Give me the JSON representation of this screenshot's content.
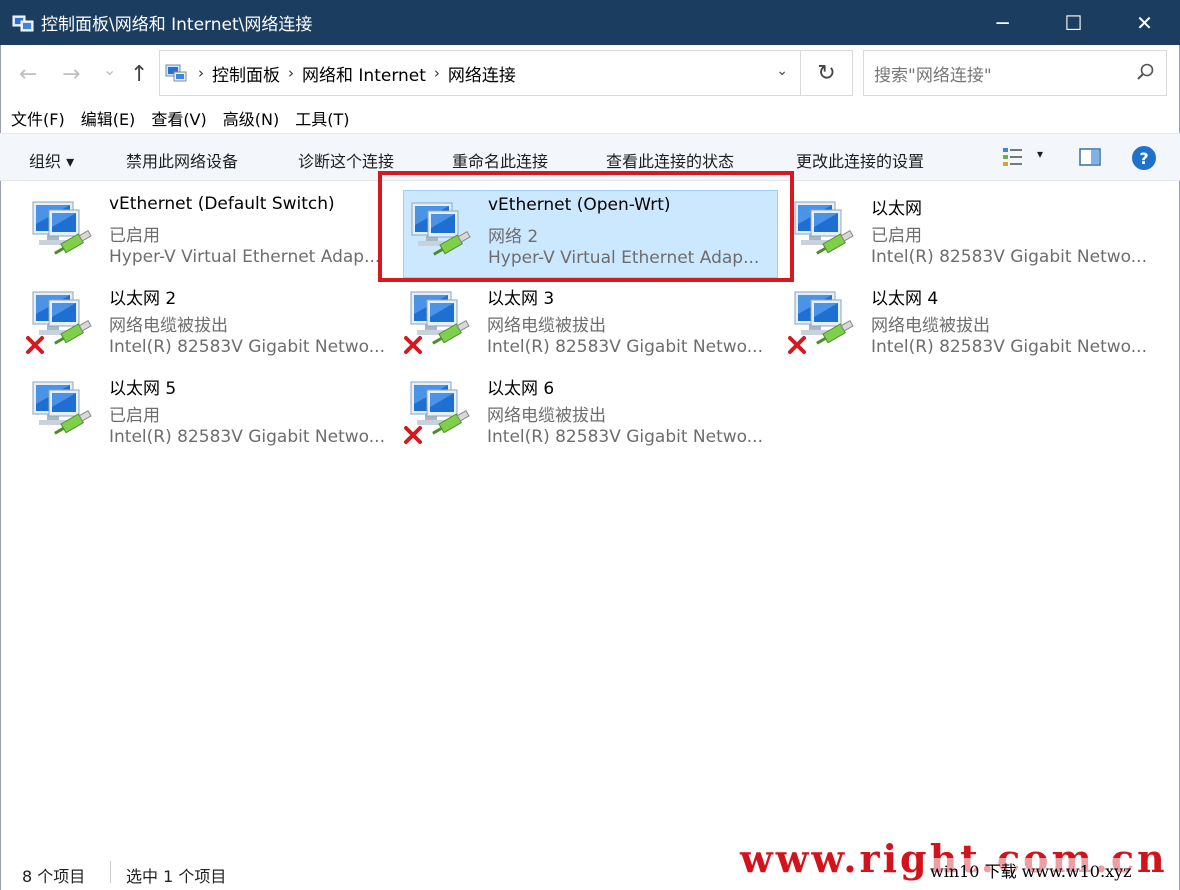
{
  "window": {
    "title": "控制面板\\网络和 Internet\\网络连接",
    "minimize": "─",
    "maximize": "☐",
    "close": "✕"
  },
  "nav": {
    "back": "←",
    "forward": "→",
    "recent": "⌄",
    "up": "↑",
    "breadcrumb": [
      "控制面板",
      "网络和 Internet",
      "网络连接"
    ],
    "dropdown": "⌄",
    "refresh": "↻",
    "search_placeholder": "搜索\"网络连接\""
  },
  "menu": [
    "文件(F)",
    "编辑(E)",
    "查看(V)",
    "高级(N)",
    "工具(T)"
  ],
  "commands": {
    "organize": "组织 ▾",
    "disable": "禁用此网络设备",
    "diagnose": "诊断这个连接",
    "rename": "重命名此连接",
    "status": "查看此连接的状态",
    "settings": "更改此连接的设置",
    "view_arrow": "▾",
    "help": "?"
  },
  "connections": [
    {
      "name": "vEthernet (Default Switch)",
      "status": "已启用",
      "adapter": "Hyper-V Virtual Ethernet Adap...",
      "unplugged": false,
      "selected": false
    },
    {
      "name": "vEthernet (Open-Wrt)",
      "status": "网络 2",
      "adapter": "Hyper-V Virtual Ethernet Adap...",
      "unplugged": false,
      "selected": true
    },
    {
      "name": "以太网",
      "status": "已启用",
      "adapter": "Intel(R) 82583V Gigabit Netwo...",
      "unplugged": false,
      "selected": false
    },
    {
      "name": "以太网 2",
      "status": "网络电缆被拔出",
      "adapter": "Intel(R) 82583V Gigabit Netwo...",
      "unplugged": true,
      "selected": false
    },
    {
      "name": "以太网 3",
      "status": "网络电缆被拔出",
      "adapter": "Intel(R) 82583V Gigabit Netwo...",
      "unplugged": true,
      "selected": false
    },
    {
      "name": "以太网 4",
      "status": "网络电缆被拔出",
      "adapter": "Intel(R) 82583V Gigabit Netwo...",
      "unplugged": true,
      "selected": false
    },
    {
      "name": "以太网 5",
      "status": "已启用",
      "adapter": "Intel(R) 82583V Gigabit Netwo...",
      "unplugged": false,
      "selected": false
    },
    {
      "name": "以太网 6",
      "status": "网络电缆被拔出",
      "adapter": "Intel(R) 82583V Gigabit Netwo...",
      "unplugged": true,
      "selected": false
    }
  ],
  "statusbar": {
    "count": "8 个项目",
    "selected": "选中 1 个项目"
  },
  "watermark": {
    "main": "www.right.com.cn",
    "secondary": "win10 下载 www.w10.xyz"
  },
  "colors": {
    "titlebar": "#1b3d5f",
    "selection": "#cce8ff",
    "highlight_box": "#d4191f",
    "watermark": "#d3131b"
  }
}
